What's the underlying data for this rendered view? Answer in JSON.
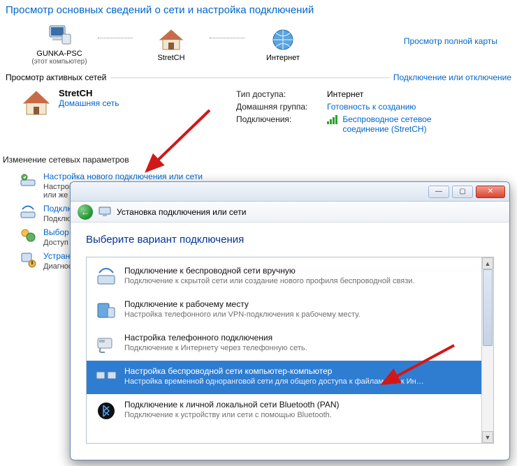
{
  "header": {
    "title": "Просмотр основных сведений о сети и настройка подключений"
  },
  "netmap": {
    "nodes": [
      {
        "label": "GUNKA-PSC",
        "sub": "(этот компьютер)"
      },
      {
        "label": "StretCH",
        "sub": ""
      },
      {
        "label": "Интернет",
        "sub": ""
      }
    ],
    "fullmap_link": "Просмотр полной карты"
  },
  "active": {
    "section_label": "Просмотр активных сетей",
    "toggle_link": "Подключение или отключение",
    "name": "StretCH",
    "type_link": "Домашняя сеть",
    "props": {
      "access_label": "Тип доступа:",
      "access_value": "Интернет",
      "homegroup_label": "Домашняя группа:",
      "homegroup_value": "Готовность к созданию",
      "connections_label": "Подключения:",
      "connections_value": "Беспроводное сетевое соединение (StretCH)"
    }
  },
  "change": {
    "section_label": "Изменение сетевых параметров",
    "items": [
      {
        "t1": "Настройка нового подключения или сети",
        "t2": "Настройка беспроводного, широкополосного, модемного, прямого или VPN-подключения или же настройка маршрутизатора или точки доступа.",
        "icon": "net-new"
      },
      {
        "t1": "Подключиться к сети",
        "t2": "Подключение или повторное подключение к беспроводному, проводному, модемному сетевому соединению или подключение к VPN.",
        "icon": "net-conn"
      },
      {
        "t1": "Выбор домашней группы и параметров общего доступа",
        "t2": "Доступ к файлам и принтерам, расположенным на других сетевых компьютерах, или изменение параметров общего доступа.",
        "icon": "net-home"
      },
      {
        "t1": "Устранение неполадок",
        "t2": "Диагностика и исправление сетевых проблем или получение сведений об исправлении.",
        "icon": "net-diag"
      }
    ]
  },
  "dialog": {
    "toolbar_title": "Установка подключения или сети",
    "heading": "Выберите вариант подключения",
    "options": [
      {
        "title": "Подключение к беспроводной сети вручную",
        "desc": "Подключение к скрытой сети или создание нового профиля беспроводной связи."
      },
      {
        "title": "Подключение к рабочему месту",
        "desc": "Настройка телефонного или VPN-подключения к рабочему месту."
      },
      {
        "title": "Настройка телефонного подключения",
        "desc": "Подключение к Интернету через телефонную сеть."
      },
      {
        "title": "Настройка беспроводной сети компьютер-компьютер",
        "desc": "Настройка временной одноранговой сети для общего доступа к файлам или к Инт..."
      },
      {
        "title": "Подключение к личной локальной сети Bluetooth (PAN)",
        "desc": "Подключение к устройству или сети с помощью Bluetooth."
      }
    ],
    "selected_index": 3
  }
}
